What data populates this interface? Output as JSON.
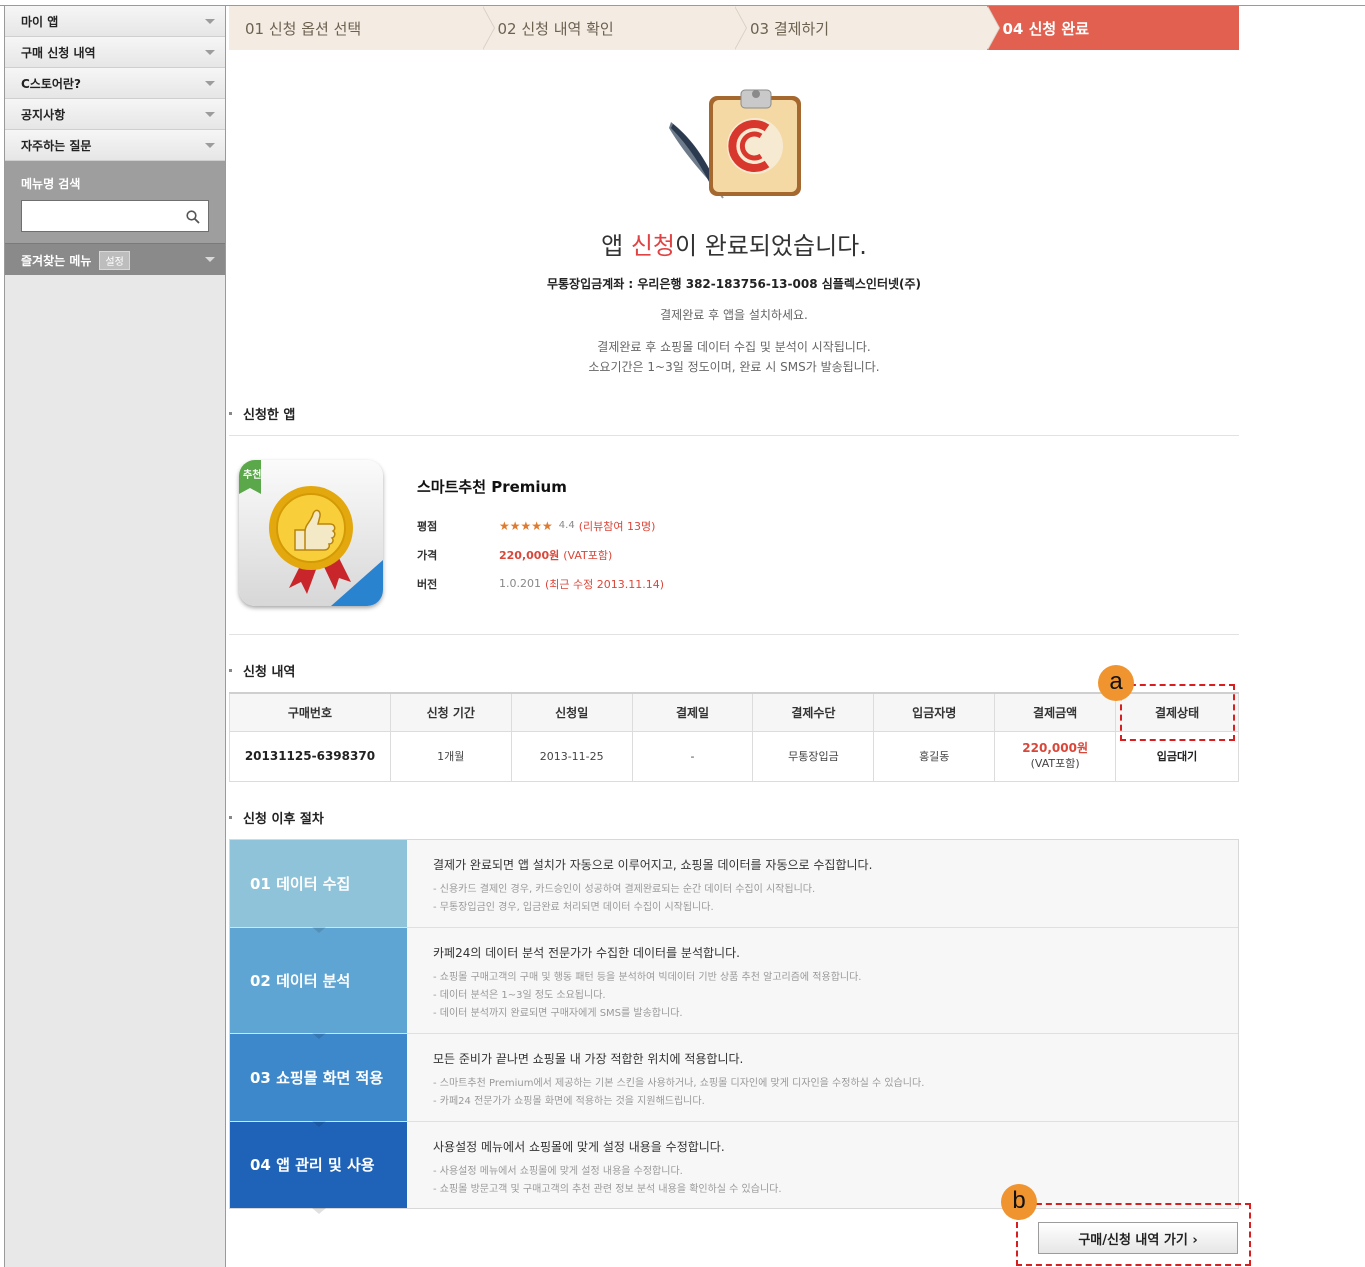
{
  "sidebar": {
    "menu": [
      {
        "label": "마이 앱"
      },
      {
        "label": "구매 신청 내역"
      },
      {
        "label": "C스토어란?"
      },
      {
        "label": "공지사항"
      },
      {
        "label": "자주하는 질문"
      }
    ],
    "search_label": "메뉴명 검색",
    "search_placeholder": "",
    "favorites_label": "즐겨찾는 메뉴",
    "favorites_setting": "설정"
  },
  "steps": [
    {
      "label": "01 신청 옵션 선택"
    },
    {
      "label": "02 신청 내역 확인"
    },
    {
      "label": "03 결제하기"
    },
    {
      "label": "04 신청 완료"
    }
  ],
  "completion": {
    "headline_pre": "앱 ",
    "headline_hl": "신청",
    "headline_post": "이 완료되었습니다.",
    "account": "무통장입금계좌 : 우리은행 382-183756-13-008 심플렉스인터넷(주)",
    "note1": "결제완료 후 앱을 설치하세요.",
    "note2": "결제완료 후 쇼핑몰 데이터 수집 및 분석이 시작됩니다.",
    "note3": "소요기간은 1~3일 정도이며, 완료 시 SMS가 발송됩니다."
  },
  "applied_app": {
    "section_title": "신청한 앱",
    "badge": "추천",
    "name": "스마트추천 Premium",
    "rating_label": "평점",
    "stars": "★★★★★",
    "rating_value": "4.4",
    "rating_reviews": "(리뷰참여 13명)",
    "price_label": "가격",
    "price": "220,000원",
    "price_vat": "(VAT포함)",
    "version_label": "버전",
    "version": "1.0.201",
    "version_updated": "(최근 수정 2013.11.14)"
  },
  "history": {
    "section_title": "신청 내역",
    "headers": [
      "구매번호",
      "신청 기간",
      "신청일",
      "결제일",
      "결제수단",
      "입금자명",
      "결제금액",
      "결제상태"
    ],
    "row": {
      "order_no": "20131125-6398370",
      "period": "1개월",
      "apply_date": "2013-11-25",
      "pay_date": "-",
      "method": "무통장입금",
      "depositor": "홍길동",
      "amount": "220,000원",
      "amount_vat": "(VAT포함)",
      "status": "입금대기"
    }
  },
  "procedure": {
    "section_title": "신청 이후 절차",
    "steps": [
      {
        "label": "01 데이터 수집",
        "color": "#8fc3d9",
        "head": "결제가 완료되면 앱 설치가 자동으로 이루어지고, 쇼핑몰 데이터를 자동으로 수집합니다.",
        "subs": [
          "- 신용카드 결제인 경우, 카드승인이 성공하여 결제완료되는 순간 데이터 수집이 시작됩니다.",
          "- 무통장입금인 경우, 입금완료 처리되면 데이터 수집이 시작됩니다."
        ]
      },
      {
        "label": "02 데이터 분석",
        "color": "#5fa5d3",
        "head": "카페24의 데이터 분석 전문가가 수집한 데이터를 분석합니다.",
        "subs": [
          "- 쇼핑몰 구매고객의 구매 및 행동 패턴 등을 분석하여 빅데이터 기반 상품 추천 알고리즘에 적용합니다.",
          "- 데이터 분석은 1~3일 정도 소요됩니다.",
          "- 데이터 분석까지 완료되면 구매자에게 SMS를 발송합니다."
        ]
      },
      {
        "label": "03 쇼핑몰 화면 적용",
        "color": "#3d88cb",
        "head": "모든 준비가 끝나면 쇼핑몰 내 가장 적합한 위치에 적용합니다.",
        "subs": [
          "- 스마트추천 Premium에서 제공하는 기본 스킨을 사용하거나, 쇼핑몰 디자인에 맞게 디자인을 수정하실 수 있습니다.",
          "- 카페24 전문가가 쇼핑몰 화면에 적용하는 것을 지원해드립니다."
        ]
      },
      {
        "label": "04 앱 관리 및 사용",
        "color": "#1e63b8",
        "head": "사용설정 메뉴에서 쇼핑몰에 맞게 설정 내용을 수정합니다.",
        "subs": [
          "- 사용설정 메뉴에서 쇼핑몰에 맞게 설정 내용을 수정합니다.",
          "- 쇼핑몰 방문고객 및 구매고객의 추천 관련 정보 분석 내용을 확인하실 수 있습니다."
        ]
      }
    ]
  },
  "go_button": "구매/신청 내역 가기 ›",
  "annotations": {
    "a": "a",
    "b": "b"
  }
}
